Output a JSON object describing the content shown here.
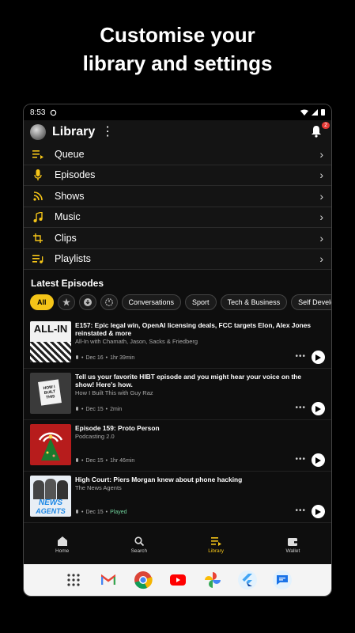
{
  "promo": {
    "line1": "Customise your",
    "line2": "library and settings"
  },
  "status": {
    "time": "8:53"
  },
  "header": {
    "title": "Library",
    "badge": "2"
  },
  "menu": [
    {
      "label": "Queue",
      "icon": "queue-icon"
    },
    {
      "label": "Episodes",
      "icon": "microphone-icon"
    },
    {
      "label": "Shows",
      "icon": "rss-icon"
    },
    {
      "label": "Music",
      "icon": "music-note-icon"
    },
    {
      "label": "Clips",
      "icon": "crop-icon"
    },
    {
      "label": "Playlists",
      "icon": "playlist-icon"
    }
  ],
  "latest": {
    "title": "Latest Episodes"
  },
  "chips": {
    "all": "All",
    "c1": "Conversations",
    "c2": "Sport",
    "c3": "Tech & Business",
    "c4": "Self Development"
  },
  "episodes": [
    {
      "title": "E157: Epic legal win, OpenAI licensing deals, FCC targets Elon, Alex Jones reinstated & more",
      "podcast": "All-In with Chamath, Jason, Sacks & Friedberg",
      "date": "Dec 16",
      "length": "1hr 39min"
    },
    {
      "title": "Tell us your favorite HIBT episode and you might hear your voice on the show! Here's how.",
      "podcast": "How I Built This with Guy Raz",
      "date": "Dec 15",
      "length": "2min"
    },
    {
      "title": "Episode 159: Proto Person",
      "podcast": "Podcasting 2.0",
      "date": "Dec 15",
      "length": "1hr 46min"
    },
    {
      "title": "High Court: Piers Morgan knew about phone hacking",
      "podcast": "The News Agents",
      "date": "Dec 15",
      "length": "Played"
    }
  ],
  "artwork": {
    "allin": "ALL-IN",
    "hibt": "HOW I BUILT THIS",
    "news1": "NEWS",
    "news2": "AGENTS"
  },
  "nav": [
    {
      "label": "Home",
      "icon": "home-icon"
    },
    {
      "label": "Search",
      "icon": "search-icon"
    },
    {
      "label": "Library",
      "icon": "library-icon"
    },
    {
      "label": "Wallet",
      "icon": "wallet-icon"
    }
  ],
  "colors": {
    "accent": "#f5c518",
    "played": "#6fd09a"
  }
}
